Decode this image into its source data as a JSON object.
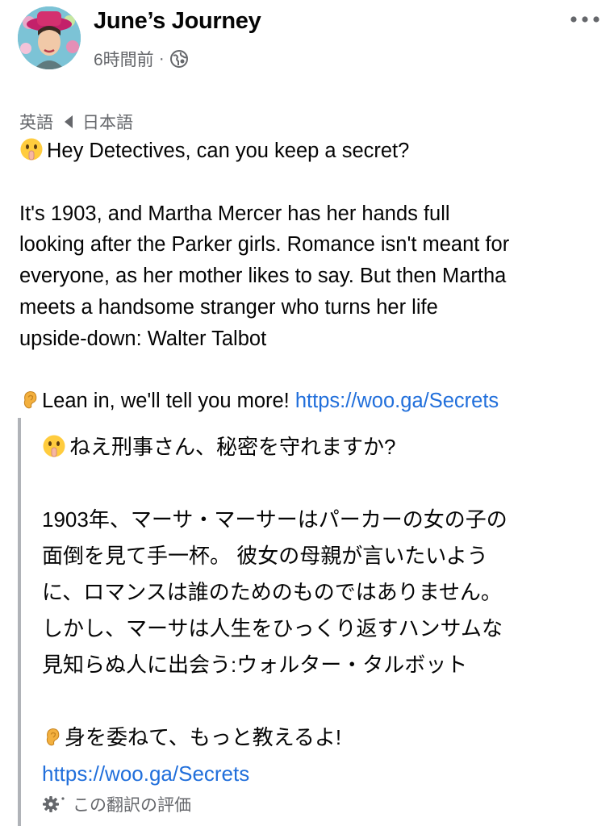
{
  "header": {
    "page_name": "June’s Journey",
    "time_ago": "6時間前",
    "separator": "·",
    "privacy_icon": "globe-icon",
    "more_icon": "more-options-icon"
  },
  "translation_bar": {
    "source_language": "英語",
    "target_language": "日本語"
  },
  "post": {
    "line1": "Hey Detectives, can you keep a secret?",
    "paragraph": "It's 1903, and Martha Mercer has her hands full\nlooking after the Parker girls. Romance isn't meant for\neveryone, as her mother likes to say. But then Martha\nmeets a handsome stranger who turns her life\nupside-down: Walter Talbot",
    "cta": "Lean in, we'll tell you more! ",
    "link": "https://woo.ga/Secrets"
  },
  "translation": {
    "line1": "ねえ刑事さん、秘密を守れますか?",
    "paragraph": "1903年、マーサ・マーサーはパーカーの女の子の\n面倒を見て手一杯。 彼女の母親が言いたいよう\nに、ロマンスは誰のためのものではありません。\nしかし、マーサは人生をひっくり返すハンサムな\n見知らぬ人に出会う:ウォルター・タルボット",
    "cta": "身を委ねて、もっと教えるよ!",
    "link": "https://woo.ga/Secrets",
    "rate_label": "この翻訳の評価"
  }
}
